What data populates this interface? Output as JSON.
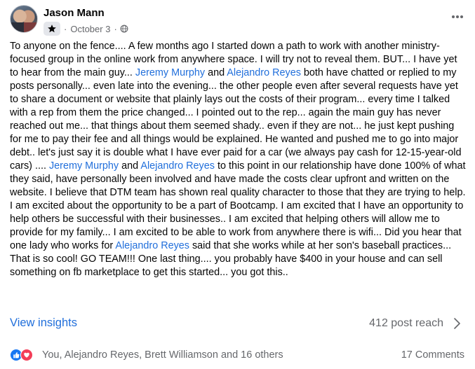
{
  "post": {
    "author": "Jason Mann",
    "date": "October 3",
    "separator": "·",
    "body": [
      {
        "t": "To anyone on the fence....  A few months ago I started down a path to work with another ministry-focused group in the online work from anywhere space. I will try not to reveal them. BUT... I have yet to hear from the main guy... "
      },
      {
        "t": "Jeremy Murphy",
        "link": true
      },
      {
        "t": " and "
      },
      {
        "t": "Alejandro Reyes",
        "link": true
      },
      {
        "t": " both have chatted or replied to my posts personally... even late into the evening... the other people even after several requests have yet to share a document or website that plainly lays out the costs of their program... every time I talked with a rep from them the price changed... I pointed out to the rep... again the main guy has never reached out me... that things about them seemed shady.. even if they are not... he just kept pushing for me to pay their fee and all things would be explained. He wanted and pushed me to go into major debt.. let's just say it is double what I have ever paid for a car (we always pay cash for 12-15-year-old cars) .... "
      },
      {
        "t": "Jeremy Murphy",
        "link": true
      },
      {
        "t": " and "
      },
      {
        "t": "Alejandro Reyes",
        "link": true
      },
      {
        "t": " to this point in our relationship have done 100% of what they said, have personally been involved and have made the costs clear upfront and written on the website. I believe that DTM team has shown real quality character to those that they are trying to help. I am excited about the opportunity to be a part of Bootcamp. I am excited that I have an opportunity to help others be successful with their businesses.. I am excited that helping others will allow me to provide for my family... I am excited to be able to work from anywhere there is wifi... Did you hear that one lady who works for "
      },
      {
        "t": "Alejandro Reyes",
        "link": true
      },
      {
        "t": " said that she works while at her son's baseball practices... That is so cool! GO TEAM!!!   One last thing.... you probably have $400 in your house and can sell something on fb marketplace to get this started... you got this.."
      }
    ]
  },
  "insights": {
    "view_label": "View insights",
    "reach_label": "412 post reach"
  },
  "footer": {
    "reactions_text": "You, Alejandro Reyes, Brett Williamson and 16 others",
    "comments_text": "17 Comments"
  },
  "icons": {
    "badge": "star-badge-icon",
    "audience": "globe-icon",
    "more": "more-options-icon",
    "chevron": "chevron-right-icon",
    "like": "like-reaction-icon",
    "love": "love-reaction-icon"
  },
  "colors": {
    "link": "#216fdb",
    "secondary_text": "#65676b",
    "like": "#1877f2",
    "love": "#f33e58"
  }
}
